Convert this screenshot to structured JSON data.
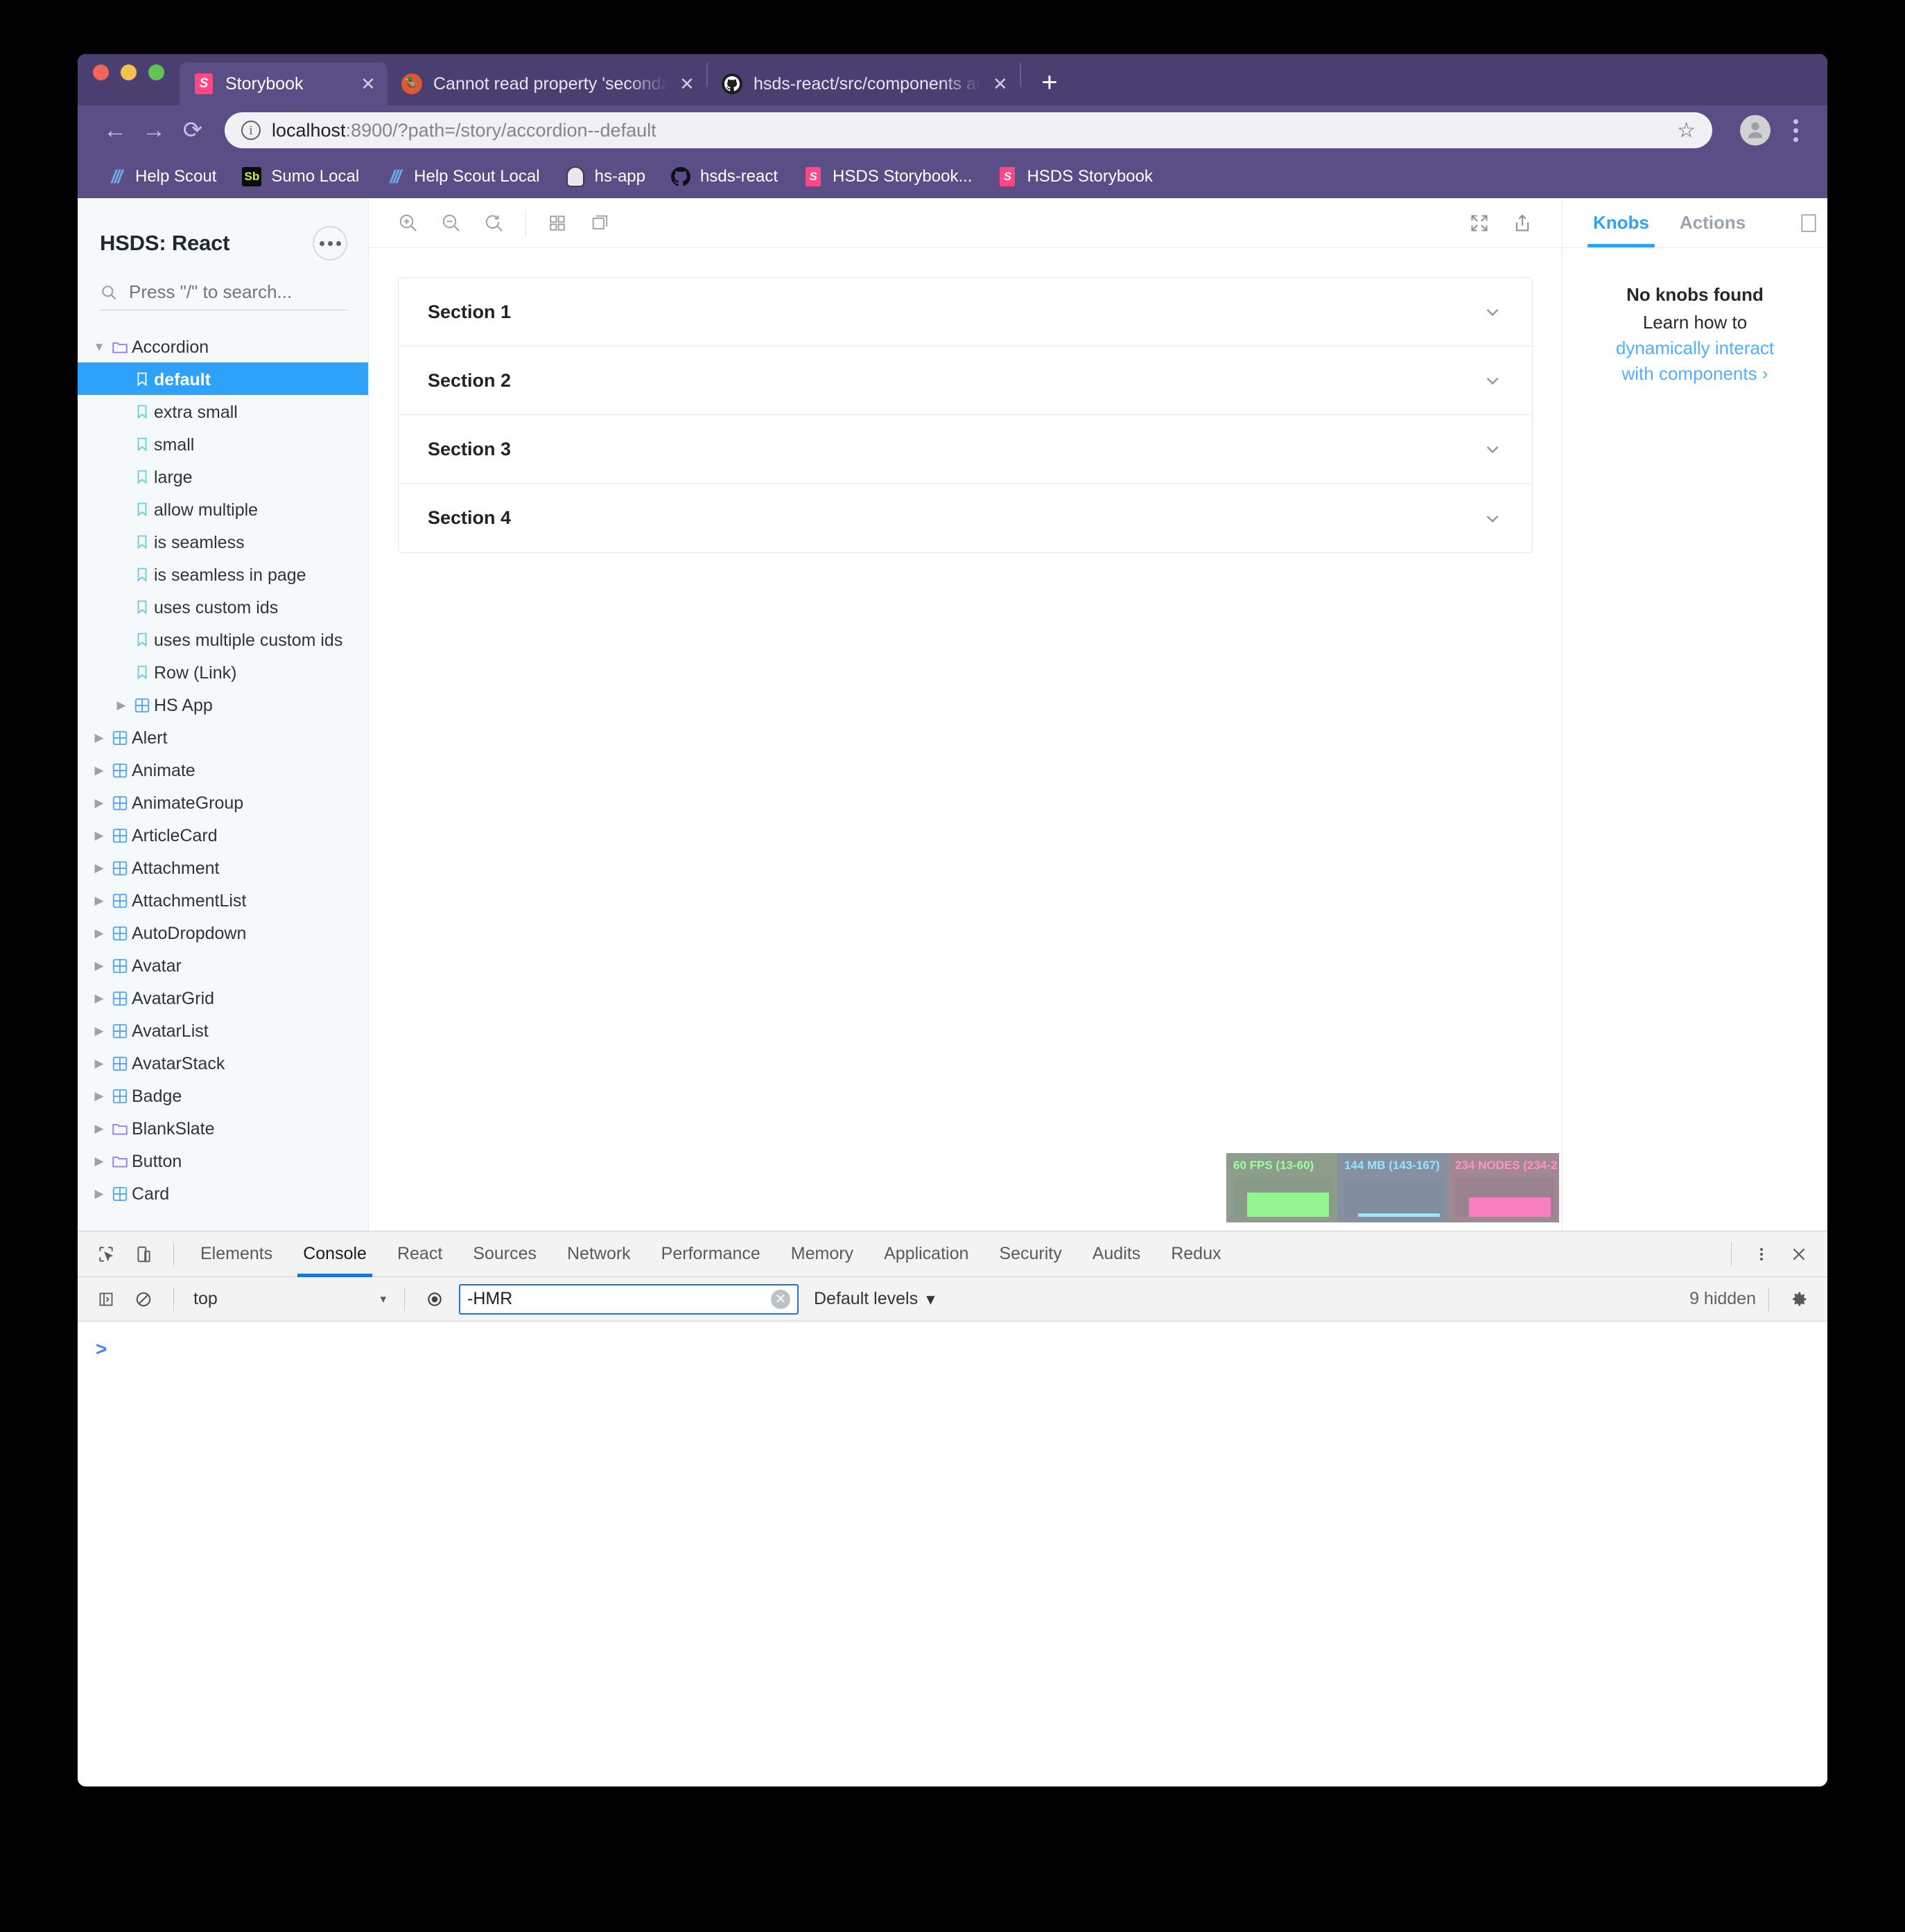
{
  "browser": {
    "tabs": [
      {
        "title": "Storybook",
        "favicon": "storybook-icon",
        "active": true
      },
      {
        "title": "Cannot read property 'seconda",
        "favicon": "duckduckgo-icon",
        "active": false
      },
      {
        "title": "hsds-react/src/components at",
        "favicon": "github-icon",
        "active": false
      }
    ],
    "new_tab_label": "+",
    "nav": {
      "back": "←",
      "forward": "→",
      "reload": "⟳"
    },
    "omnibox": {
      "url_host": "localhost",
      "url_rest": ":8900/?path=/story/accordion--default",
      "info_icon": "info-icon",
      "star_icon": "star-icon"
    },
    "bookmarks": [
      {
        "label": "Help Scout",
        "icon": "helpscout-icon"
      },
      {
        "label": "Sumo Local",
        "icon": "sumo-icon"
      },
      {
        "label": "Help Scout Local",
        "icon": "helpscout-icon"
      },
      {
        "label": "hs-app",
        "icon": "hsapp-icon"
      },
      {
        "label": "hsds-react",
        "icon": "github-icon"
      },
      {
        "label": "HSDS Storybook...",
        "icon": "storybook-icon"
      },
      {
        "label": "HSDS Storybook",
        "icon": "storybook-icon"
      }
    ]
  },
  "storybook": {
    "sidebar": {
      "title": "HSDS: React",
      "menu_icon": "ellipsis-icon",
      "search_placeholder": "Press \"/\" to search...",
      "tree": [
        {
          "label": "Accordion",
          "level": 0,
          "icon": "folder-icon",
          "caret": "down",
          "selected": false
        },
        {
          "label": "default",
          "level": 1,
          "icon": "bookmark-icon",
          "caret": "none",
          "selected": true
        },
        {
          "label": "extra small",
          "level": 1,
          "icon": "bookmark-icon",
          "caret": "none",
          "selected": false
        },
        {
          "label": "small",
          "level": 1,
          "icon": "bookmark-icon",
          "caret": "none",
          "selected": false
        },
        {
          "label": "large",
          "level": 1,
          "icon": "bookmark-icon",
          "caret": "none",
          "selected": false
        },
        {
          "label": "allow multiple",
          "level": 1,
          "icon": "bookmark-icon",
          "caret": "none",
          "selected": false
        },
        {
          "label": "is seamless",
          "level": 1,
          "icon": "bookmark-icon",
          "caret": "none",
          "selected": false
        },
        {
          "label": "is seamless in page",
          "level": 1,
          "icon": "bookmark-icon",
          "caret": "none",
          "selected": false
        },
        {
          "label": "uses custom ids",
          "level": 1,
          "icon": "bookmark-icon",
          "caret": "none",
          "selected": false
        },
        {
          "label": "uses multiple custom ids",
          "level": 1,
          "icon": "bookmark-icon",
          "caret": "none",
          "selected": false
        },
        {
          "label": "Row (Link)",
          "level": 1,
          "icon": "bookmark-icon",
          "caret": "none",
          "selected": false
        },
        {
          "label": "HS App",
          "level": 1,
          "icon": "component-icon",
          "caret": "right",
          "selected": false
        },
        {
          "label": "Alert",
          "level": 0,
          "icon": "component-icon",
          "caret": "right",
          "selected": false
        },
        {
          "label": "Animate",
          "level": 0,
          "icon": "component-icon",
          "caret": "right",
          "selected": false
        },
        {
          "label": "AnimateGroup",
          "level": 0,
          "icon": "component-icon",
          "caret": "right",
          "selected": false
        },
        {
          "label": "ArticleCard",
          "level": 0,
          "icon": "component-icon",
          "caret": "right",
          "selected": false
        },
        {
          "label": "Attachment",
          "level": 0,
          "icon": "component-icon",
          "caret": "right",
          "selected": false
        },
        {
          "label": "AttachmentList",
          "level": 0,
          "icon": "component-icon",
          "caret": "right",
          "selected": false
        },
        {
          "label": "AutoDropdown",
          "level": 0,
          "icon": "component-icon",
          "caret": "right",
          "selected": false
        },
        {
          "label": "Avatar",
          "level": 0,
          "icon": "component-icon",
          "caret": "right",
          "selected": false
        },
        {
          "label": "AvatarGrid",
          "level": 0,
          "icon": "component-icon",
          "caret": "right",
          "selected": false
        },
        {
          "label": "AvatarList",
          "level": 0,
          "icon": "component-icon",
          "caret": "right",
          "selected": false
        },
        {
          "label": "AvatarStack",
          "level": 0,
          "icon": "component-icon",
          "caret": "right",
          "selected": false
        },
        {
          "label": "Badge",
          "level": 0,
          "icon": "component-icon",
          "caret": "right",
          "selected": false
        },
        {
          "label": "BlankSlate",
          "level": 0,
          "icon": "folder-icon",
          "caret": "right",
          "selected": false
        },
        {
          "label": "Button",
          "level": 0,
          "icon": "folder-icon",
          "caret": "right",
          "selected": false
        },
        {
          "label": "Card",
          "level": 0,
          "icon": "component-icon",
          "caret": "right",
          "selected": false
        }
      ]
    },
    "toolbar": {
      "zoom_in": "zoom-in-icon",
      "zoom_out": "zoom-out-icon",
      "zoom_reset": "zoom-reset-icon",
      "grid": "grid-icon",
      "background": "background-icon",
      "fullscreen": "fullscreen-icon",
      "open_new_tab": "share-icon"
    },
    "preview": {
      "accordion_sections": [
        "Section 1",
        "Section 2",
        "Section 3",
        "Section 4"
      ],
      "chevron_icon": "chevron-down-icon"
    },
    "stats": [
      {
        "label": "60 FPS (13-60)",
        "kind": "fps"
      },
      {
        "label": "144 MB (143-167)",
        "kind": "memory"
      },
      {
        "label": "234 NODES (234-2",
        "kind": "nodes"
      }
    ],
    "panel": {
      "tabs": [
        {
          "label": "Knobs",
          "active": true
        },
        {
          "label": "Actions",
          "active": false
        }
      ],
      "layout_icon": "panel-layout-icon",
      "empty_title": "No knobs found",
      "empty_line": "Learn how to",
      "empty_link1": "dynamically interact",
      "empty_link2": "with components ›",
      "accent_color": "#2ea1f8"
    }
  },
  "devtools": {
    "inspect_icon": "inspect-icon",
    "device_icon": "device-toolbar-icon",
    "tabs": [
      {
        "label": "Elements",
        "active": false
      },
      {
        "label": "Console",
        "active": true
      },
      {
        "label": "React",
        "active": false
      },
      {
        "label": "Sources",
        "active": false
      },
      {
        "label": "Network",
        "active": false
      },
      {
        "label": "Performance",
        "active": false
      },
      {
        "label": "Memory",
        "active": false
      },
      {
        "label": "Application",
        "active": false
      },
      {
        "label": "Security",
        "active": false
      },
      {
        "label": "Audits",
        "active": false
      },
      {
        "label": "Redux",
        "active": false
      }
    ],
    "more_icon": "kebab-icon",
    "close_icon": "close-icon",
    "console_toolbar": {
      "sidebar_icon": "console-sidebar-icon",
      "clear_icon": "clear-console-icon",
      "context": "top",
      "context_caret": "▾",
      "eye_icon": "live-expression-icon",
      "filter_value": "-HMR",
      "filter_clear_icon": "clear-filter-icon",
      "levels_label": "Default levels",
      "levels_caret": "▾",
      "hidden_label": "9 hidden",
      "settings_icon": "gear-icon"
    },
    "prompt": ">",
    "active_tab_color": "#1a73e8"
  }
}
